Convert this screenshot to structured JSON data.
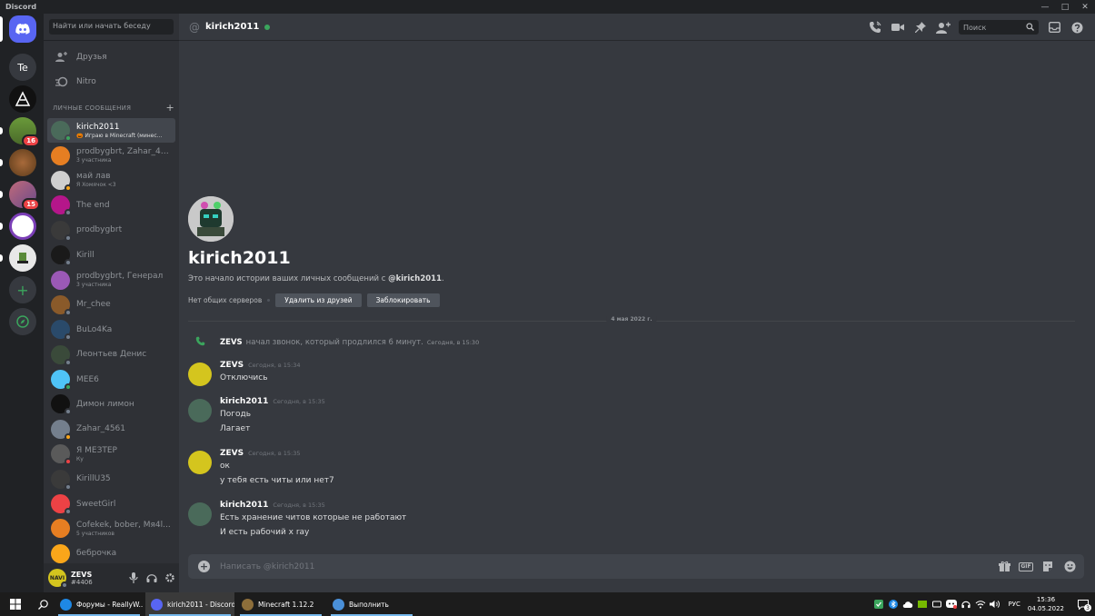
{
  "window": {
    "title": "Discord"
  },
  "servers": [
    {
      "type": "home",
      "color": "#5865f2"
    },
    {
      "label": "Te",
      "color": "#36393f"
    },
    {
      "color": "#111111"
    },
    {
      "color": "#5c8a3a",
      "badge": "16"
    },
    {
      "color": "#7a4a2a"
    },
    {
      "color": "#9a5a6a",
      "badge": "15"
    },
    {
      "color": "#7b3fb7"
    },
    {
      "color": "#e8e8e8"
    }
  ],
  "sidebar": {
    "search_placeholder": "Найти или начать беседу",
    "nav": {
      "friends": "Друзья",
      "nitro": "Nitro"
    },
    "dm_header": "ЛИЧНЫЕ СООБЩЕНИЯ",
    "dms": [
      {
        "name": "kirich2011",
        "sub": "🎃 Играю в Minecraft (минес...",
        "color": "#4a6a5a",
        "status": "#3ba55d",
        "active": true
      },
      {
        "name": "prodbygbrt, Zahar_4561",
        "sub": "3 участника",
        "color": "#e67e22",
        "status": ""
      },
      {
        "name": "май лав",
        "sub": "Я Хомячок <3",
        "color": "#cfcfcf",
        "status": "#faa61a"
      },
      {
        "name": "The end",
        "sub": "",
        "color": "#b5168a",
        "status": "#747f8d"
      },
      {
        "name": "prodbygbrt",
        "sub": "",
        "color": "#3a3a3a",
        "status": "#747f8d"
      },
      {
        "name": "Kirill",
        "sub": "",
        "color": "#1a1a1a",
        "status": "#747f8d"
      },
      {
        "name": "prodbygbrt, Генерал",
        "sub": "3 участника",
        "color": "#9b59b6",
        "status": ""
      },
      {
        "name": "Mr_chee",
        "sub": "",
        "color": "#8a5a2a",
        "status": "#747f8d"
      },
      {
        "name": "BuLo4Ka",
        "sub": "",
        "color": "#2a4a6a",
        "status": "#747f8d"
      },
      {
        "name": "Леонтьев Денис",
        "sub": "",
        "color": "#3a4a3a",
        "status": "#747f8d"
      },
      {
        "name": "MEE6",
        "sub": "",
        "color": "#4fc3f7",
        "status": "#3ba55d"
      },
      {
        "name": "Димон лимон",
        "sub": "",
        "color": "#111111",
        "status": "#747f8d"
      },
      {
        "name": "Zahar_4561",
        "sub": "",
        "color": "#747f8d",
        "status": "#faa61a"
      },
      {
        "name": "Я МЕЗТЕР",
        "sub": "Ку",
        "color": "#5a5a5a",
        "status": "#ed4245"
      },
      {
        "name": "KirillU35",
        "sub": "",
        "color": "#3a3a3a",
        "status": "#747f8d"
      },
      {
        "name": "SweetGirl",
        "sub": "",
        "color": "#ed4245",
        "status": "#747f8d"
      },
      {
        "name": "Cofekek, bober, Мя4l...",
        "sub": "5 участников",
        "color": "#e67e22",
        "status": ""
      },
      {
        "name": "беброчка",
        "sub": "",
        "color": "#faa61a",
        "status": ""
      }
    ]
  },
  "user": {
    "name": "ZEVS",
    "tag": "#4406",
    "avatar_text": "NAVI"
  },
  "chat": {
    "at_symbol": "@",
    "title": "kirich2011",
    "search_placeholder": "Поиск",
    "intro": {
      "name": "kirich2011",
      "desc_prefix": "Это начало истории ваших личных сообщений с ",
      "desc_user": "@kirich2011",
      "desc_suffix": ".",
      "no_mutual": "Нет общих серверов",
      "remove_friend": "Удалить из друзей",
      "block": "Заблокировать"
    },
    "date_divider": "4 мая 2022 г.",
    "call": {
      "who": "ZEVS",
      "text": "начал звонок, который продлился 6 минут.",
      "ts": "Сегодня, в 15:30"
    },
    "messages": [
      {
        "author": "ZEVS",
        "ts": "Сегодня, в 15:34",
        "avatar": "#d4c51e",
        "lines": [
          "Отключись"
        ]
      },
      {
        "author": "kirich2011",
        "ts": "Сегодня, в 15:35",
        "avatar": "#4a6a5a",
        "lines": [
          "Погодь",
          "Лагает"
        ]
      },
      {
        "author": "ZEVS",
        "ts": "Сегодня, в 15:35",
        "avatar": "#d4c51e",
        "lines": [
          "ок",
          "у тебя есть читы или нет7"
        ]
      },
      {
        "author": "kirich2011",
        "ts": "Сегодня, в 15:35",
        "avatar": "#4a6a5a",
        "lines": [
          "Есть хранение читов которые не работают",
          "И есть рабочий x ray"
        ]
      }
    ],
    "composer_placeholder": "Написать @kirich2011",
    "gif_label": "GIF"
  },
  "taskbar": {
    "apps": [
      {
        "label": "Форумы - ReallyW...",
        "color": "#1e88e5",
        "active": false
      },
      {
        "label": "kirich2011 - Discord",
        "color": "#5865f2",
        "active": true
      },
      {
        "label": "Minecraft 1.12.2",
        "color": "#8d6e3a",
        "active": false
      },
      {
        "label": "Выполнить",
        "color": "#4a90d9",
        "active": false
      }
    ],
    "lang": "РУС",
    "time": "15:36",
    "date": "04.05.2022",
    "notifications": "3"
  }
}
